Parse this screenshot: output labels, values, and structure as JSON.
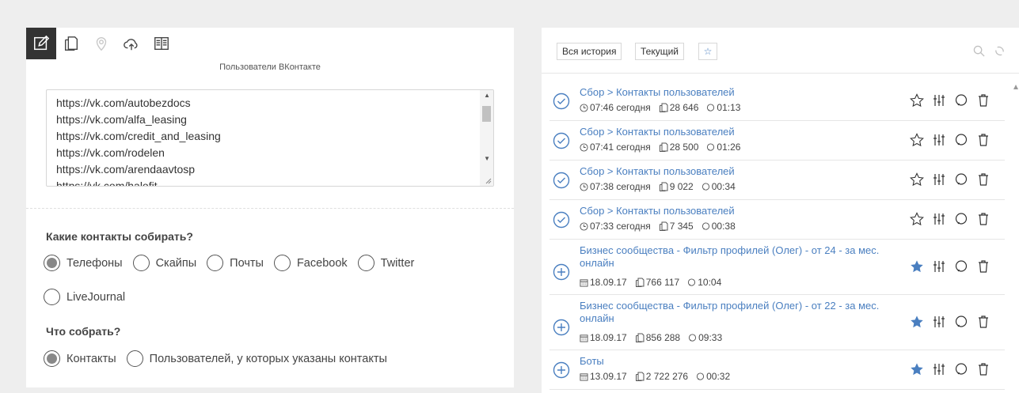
{
  "left": {
    "toolbar": [
      "edit-icon",
      "copy-icon",
      "location-icon",
      "cloud-upload-icon",
      "book-icon"
    ],
    "section_label": "Пользователи ВКонтакте",
    "textarea_lines": [
      "https://vk.com/autobezdocs",
      "https://vk.com/alfa_leasing",
      "https://vk.com/credit_and_leasing",
      "https://vk.com/rodelen",
      "https://vk.com/arendaavtosp",
      "https://vk.com/halofit"
    ],
    "q1": "Какие контакты собирать?",
    "contact_options": [
      {
        "label": "Телефоны",
        "checked": true
      },
      {
        "label": "Скайпы",
        "checked": false
      },
      {
        "label": "Почты",
        "checked": false
      },
      {
        "label": "Facebook",
        "checked": false
      },
      {
        "label": "Twitter",
        "checked": false
      },
      {
        "label": "LiveJournal",
        "checked": false
      }
    ],
    "q2": "Что собрать?",
    "collect_options": [
      {
        "label": "Контакты",
        "checked": true
      },
      {
        "label": "Пользователей, у которых указаны контакты",
        "checked": false
      }
    ]
  },
  "right": {
    "tabs": [
      "Вся история",
      "Текущий"
    ],
    "accent": "#4a7fc0",
    "items": [
      {
        "title": "Сбор > Контакты пользователей",
        "kind": "check",
        "date_icon": "clock",
        "date": "07:46 сегодня",
        "count": "28 646",
        "duration": "01:13",
        "starred": false
      },
      {
        "title": "Сбор > Контакты пользователей",
        "kind": "check",
        "date_icon": "clock",
        "date": "07:41 сегодня",
        "count": "28 500",
        "duration": "01:26",
        "starred": false
      },
      {
        "title": "Сбор > Контакты пользователей",
        "kind": "check",
        "date_icon": "clock",
        "date": "07:38 сегодня",
        "count": "9 022",
        "duration": "00:34",
        "starred": false
      },
      {
        "title": "Сбор > Контакты пользователей",
        "kind": "check",
        "date_icon": "clock",
        "date": "07:33 сегодня",
        "count": "7 345",
        "duration": "00:38",
        "starred": false
      },
      {
        "title": "Бизнес сообщества - Фильтр профилей (Олег) - от 24 - за мес. онлайн",
        "kind": "plus",
        "date_icon": "calendar",
        "date": "18.09.17",
        "count": "766 117",
        "duration": "10:04",
        "starred": true
      },
      {
        "title": "Бизнес сообщества - Фильтр профилей (Олег) - от 22 - за мес. онлайн",
        "kind": "plus",
        "date_icon": "calendar",
        "date": "18.09.17",
        "count": "856 288",
        "duration": "09:33",
        "starred": true
      },
      {
        "title": "Боты",
        "kind": "plus",
        "date_icon": "calendar",
        "date": "13.09.17",
        "count": "2 722 276",
        "duration": "00:32",
        "starred": true
      }
    ]
  }
}
